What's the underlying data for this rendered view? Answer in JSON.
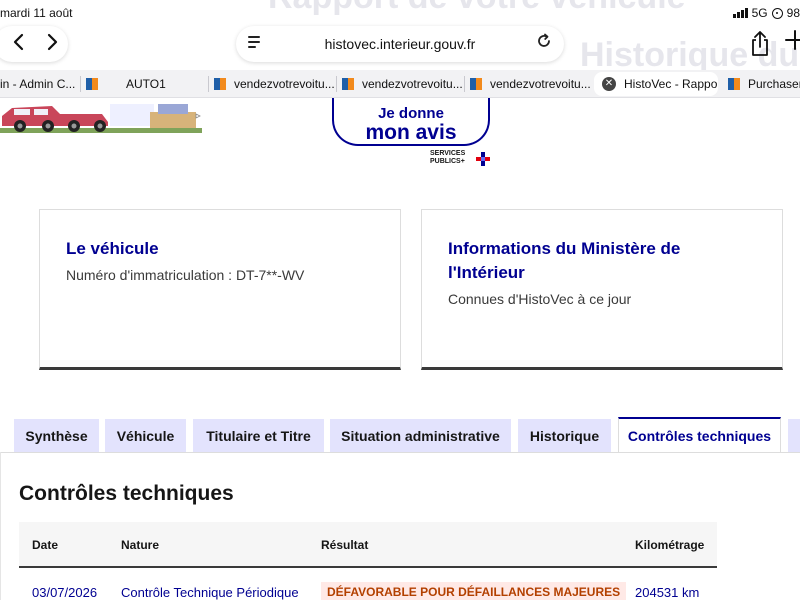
{
  "status_bar": {
    "date": "mardi 11 août",
    "network": "5G",
    "battery": "98"
  },
  "background_text": {
    "line1": "Rapport de votre véhicule",
    "line2": "Historique du"
  },
  "browser": {
    "url": "histovec.interieur.gouv.fr",
    "tabs": [
      {
        "label": "in - Admin C..."
      },
      {
        "label": "AUTO1"
      },
      {
        "label": "vendezvotrevoitu..."
      },
      {
        "label": "vendezvotrevoitu..."
      },
      {
        "label": "vendezvotrevoitu..."
      },
      {
        "label": "HistoVec - Rappo..."
      },
      {
        "label": "Purchaser"
      }
    ]
  },
  "feedback": {
    "line1": "Je donne",
    "line2": "mon avis",
    "logo_text1": "SERVICES",
    "logo_text2": "PUBLICS+"
  },
  "cards": {
    "vehicle": {
      "title": "Le véhicule",
      "desc": "Numéro d'immatriculation : DT-7**-WV"
    },
    "ministry": {
      "title_line1": "Informations du Ministère de",
      "title_line2": "l'Intérieur",
      "desc": "Connues d'HistoVec à ce jour"
    }
  },
  "page_tabs": [
    {
      "label": "Synthèse"
    },
    {
      "label": "Véhicule"
    },
    {
      "label": "Titulaire et Titre"
    },
    {
      "label": "Situation administrative"
    },
    {
      "label": "Historique"
    },
    {
      "label": "Contrôles techniques",
      "active": true
    }
  ],
  "controls": {
    "title": "Contrôles techniques",
    "columns": [
      "Date",
      "Nature",
      "Résultat",
      "Kilométrage"
    ],
    "rows": [
      {
        "date": "03/07/2026",
        "nature": "Contrôle Technique Périodique",
        "result": "DÉFAVORABLE POUR DÉFAILLANCES MAJEURES",
        "mileage": "204531 km"
      }
    ]
  },
  "colors": {
    "primary_blue": "#000091",
    "tab_bg": "#e3e3fd",
    "error_text": "#b34000",
    "error_bg": "#ffe9e6"
  }
}
